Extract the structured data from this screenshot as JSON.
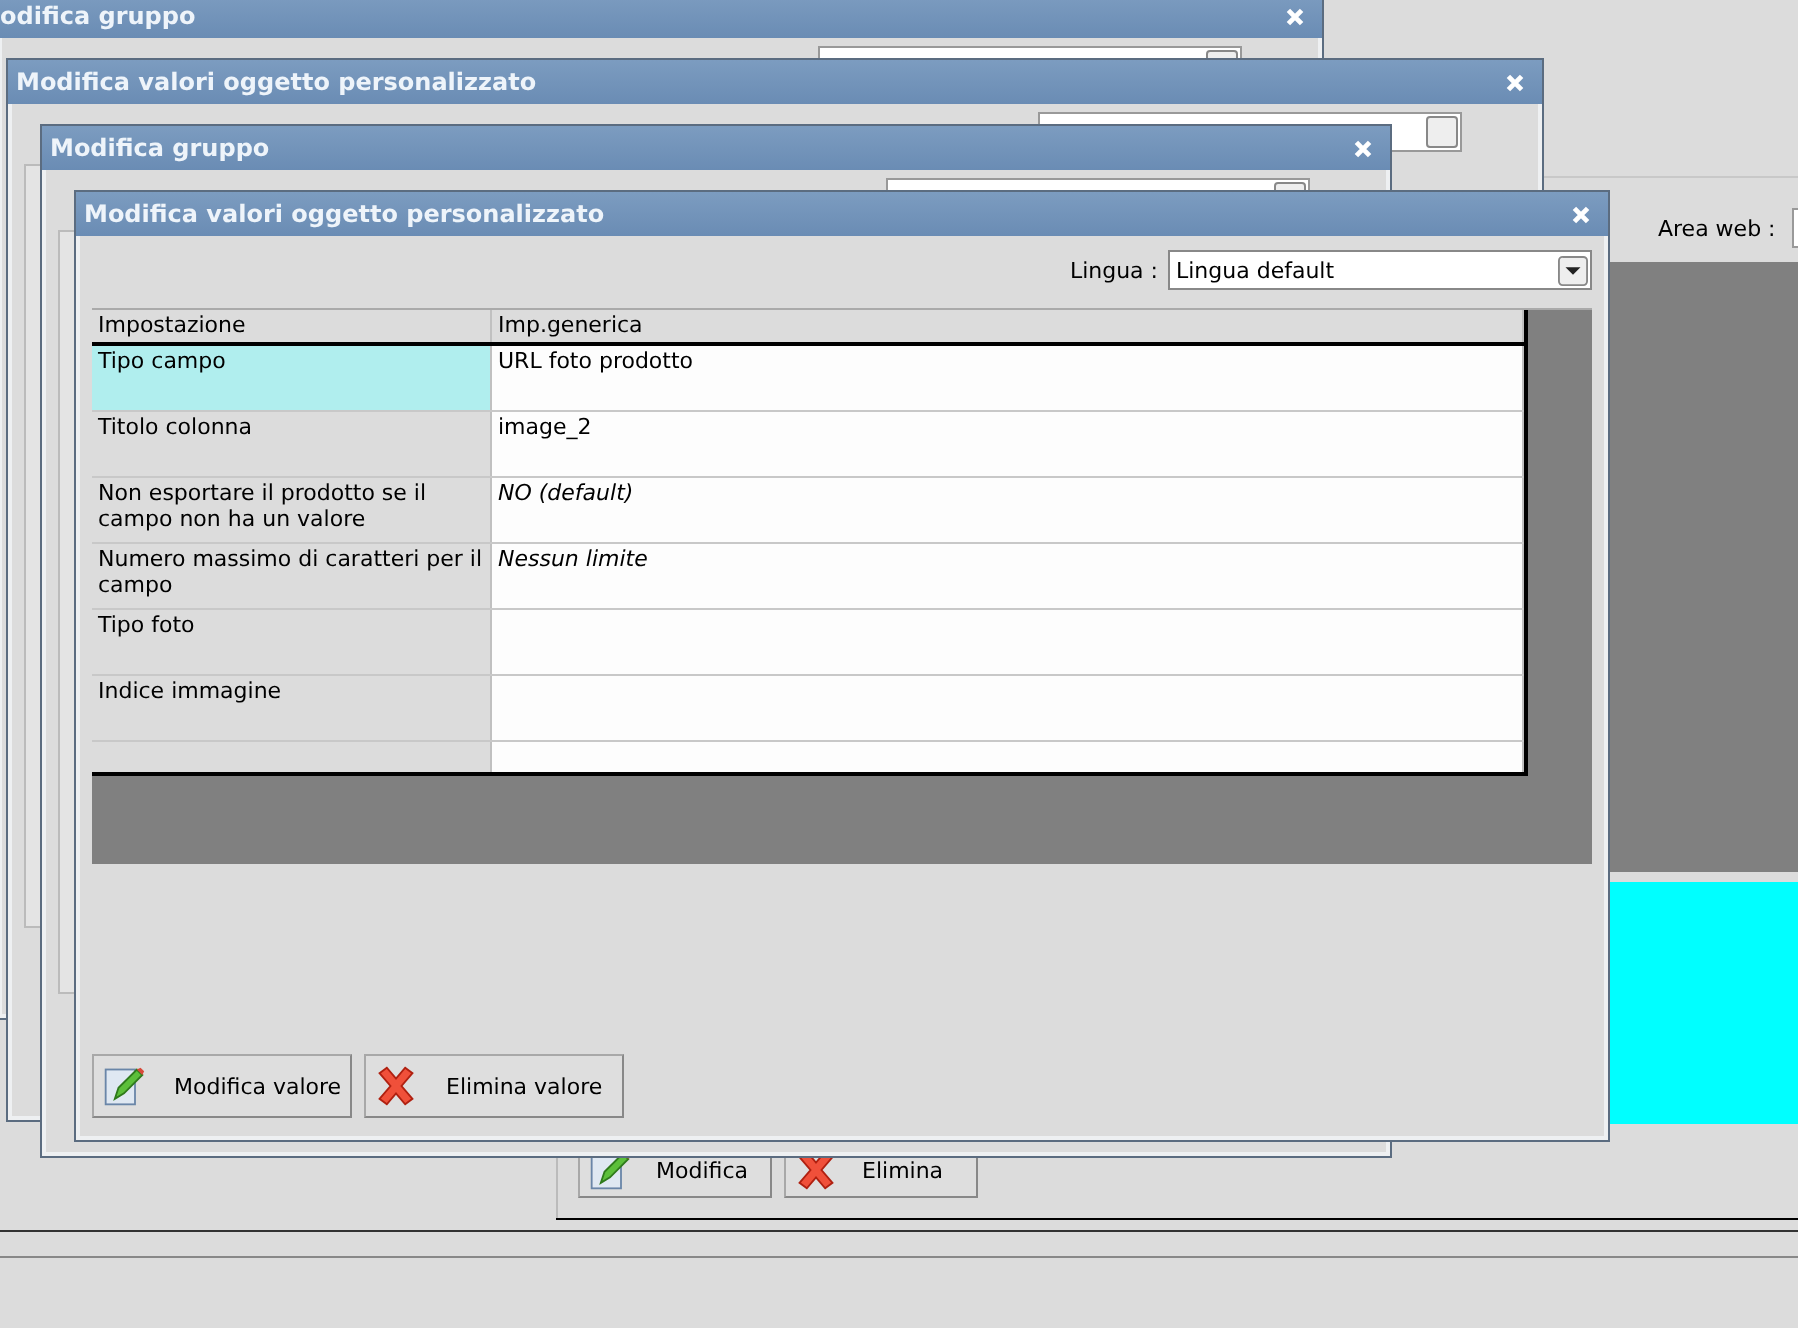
{
  "app": {
    "area_web_label": "Area web :",
    "buttons": [
      {
        "label": "Modifica",
        "kind": "edit"
      },
      {
        "label": "Elimina",
        "kind": "delete"
      }
    ]
  },
  "background_windows": [
    {
      "title": "odifica gruppo"
    },
    {
      "title": "Modifica valori oggetto personalizzato"
    },
    {
      "title": "Modifica gruppo"
    }
  ],
  "dialog": {
    "title": "Modifica valori oggetto personalizzato",
    "language_label": "Lingua :",
    "language_value": "Lingua default",
    "table": {
      "columns": [
        "Impostazione",
        "Imp.generica"
      ],
      "rows": [
        {
          "setting": "Tipo campo",
          "value": "URL foto prodotto",
          "kind": "set",
          "selected": true
        },
        {
          "setting": "Titolo colonna",
          "value": "image_2",
          "kind": "set",
          "selected": false
        },
        {
          "setting": "Non esportare il prodotto se il campo non ha un valore",
          "value": "NO (default)",
          "kind": "default",
          "selected": false
        },
        {
          "setting": "Numero massimo di caratteri per il campo",
          "value": "Nessun limite",
          "kind": "default",
          "selected": false
        },
        {
          "setting": "Tipo foto",
          "kind": "set",
          "selected": false
        },
        {
          "setting": "Indice immagine",
          "kind": "set",
          "selected": false
        },
        {
          "kind": "empty",
          "selected": false
        }
      ]
    },
    "buttons": [
      {
        "label": "Modifica valore",
        "kind": "edit"
      },
      {
        "label": "Elimina valore",
        "kind": "delete"
      }
    ]
  }
}
